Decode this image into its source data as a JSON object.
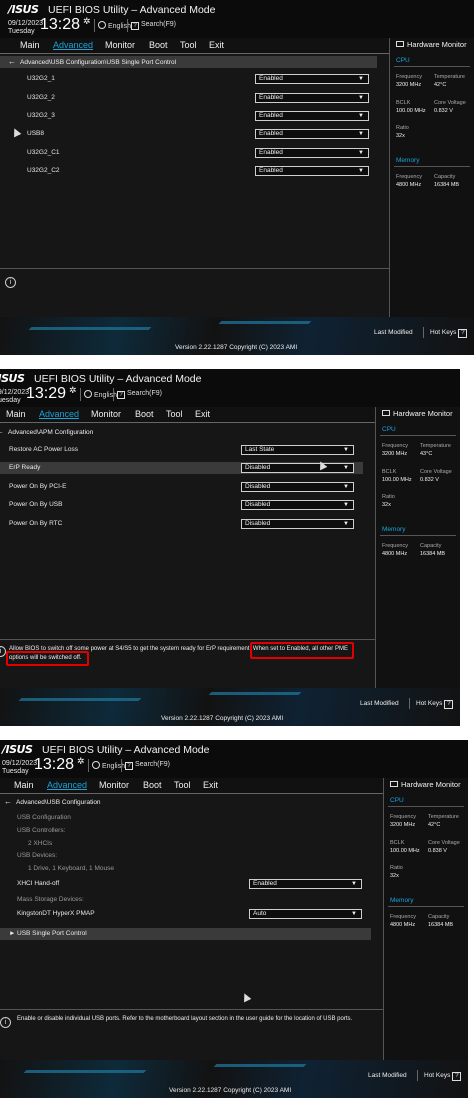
{
  "common": {
    "logo": "/ISUS",
    "title": "UEFI BIOS Utility – Advanced Mode",
    "date": "09/12/2023",
    "weekday": "Tuesday",
    "language": "English",
    "search": "Search(F9)",
    "menu": [
      "Main",
      "Advanced",
      "Monitor",
      "Boot",
      "Tool",
      "Exit"
    ],
    "hw_title": "Hardware Monitor",
    "cpu": "CPU",
    "frequency": "Frequency",
    "temperature": "Temperature",
    "bclk": "BCLK",
    "core_voltage": "Core Voltage",
    "ratio": "Ratio",
    "ratio_val": "32x",
    "bclk_val": "100.00 MHz",
    "cpu_freq": "3200 MHz",
    "memory": "Memory",
    "capacity": "Capacity",
    "mem_freq": "4800 MHz",
    "mem_cap": "16384 MB",
    "last_modified": "Last Modified",
    "hot_keys": "Hot Keys",
    "version": "Version 2.22.1287 Copyright (C) 2023 AMI",
    "accent": "#1aa3d9",
    "highlight_color": "#e00000"
  },
  "screen1": {
    "time": "13:28",
    "breadcrumb": "Advanced\\USB Configuration\\USB Single Port Control",
    "temp": "42°C",
    "voltage": "0.832 V",
    "rows": [
      {
        "label": "U32G2_1",
        "value": "Enabled"
      },
      {
        "label": "U32G2_2",
        "value": "Enabled"
      },
      {
        "label": "U32G2_3",
        "value": "Enabled"
      },
      {
        "label": "USB8",
        "value": "Enabled"
      },
      {
        "label": "U32G2_C1",
        "value": "Enabled"
      },
      {
        "label": "U32G2_C2",
        "value": "Enabled"
      }
    ]
  },
  "screen2": {
    "time": "13:29",
    "breadcrumb": "Advanced\\APM Configuration",
    "temp": "43°C",
    "voltage": "0.832 V",
    "rows": [
      {
        "label": "Restore AC Power Loss",
        "value": "Last State"
      },
      {
        "label": "ErP Ready",
        "value": "Disabled"
      },
      {
        "label": "Power On By PCI-E",
        "value": "Disabled"
      },
      {
        "label": "Power On By USB",
        "value": "Disabled"
      },
      {
        "label": "Power On By RTC",
        "value": "Disabled"
      }
    ],
    "help_a": "Allow BIOS to switch off some power at S4/S5 to get the system ready for ErP requirement.",
    "help_b": "When set to Enabled, all other PME",
    "help_c": "options will be switched off."
  },
  "screen3": {
    "time": "13:28",
    "breadcrumb": "Advanced\\USB Configuration",
    "temp": "42°C",
    "voltage": "0.838 V",
    "usb_configuration": "USB Configuration",
    "usb_controllers": "USB Controllers:",
    "controllers_val": "2 XHCIs",
    "usb_devices": "USB Devices:",
    "devices_val": "1 Drive, 1 Keyboard, 1 Mouse",
    "xhci_label": "XHCI Hand-off",
    "xhci_value": "Enabled",
    "mass_storage": "Mass Storage Devices:",
    "kingston_label": "KingstonDT HyperX PMAP",
    "kingston_value": "Auto",
    "single_port": "USB Single Port Control",
    "help": "Enable or disable individual USB ports. Refer to the motherboard layout section in the user guide for the location of USB ports."
  }
}
